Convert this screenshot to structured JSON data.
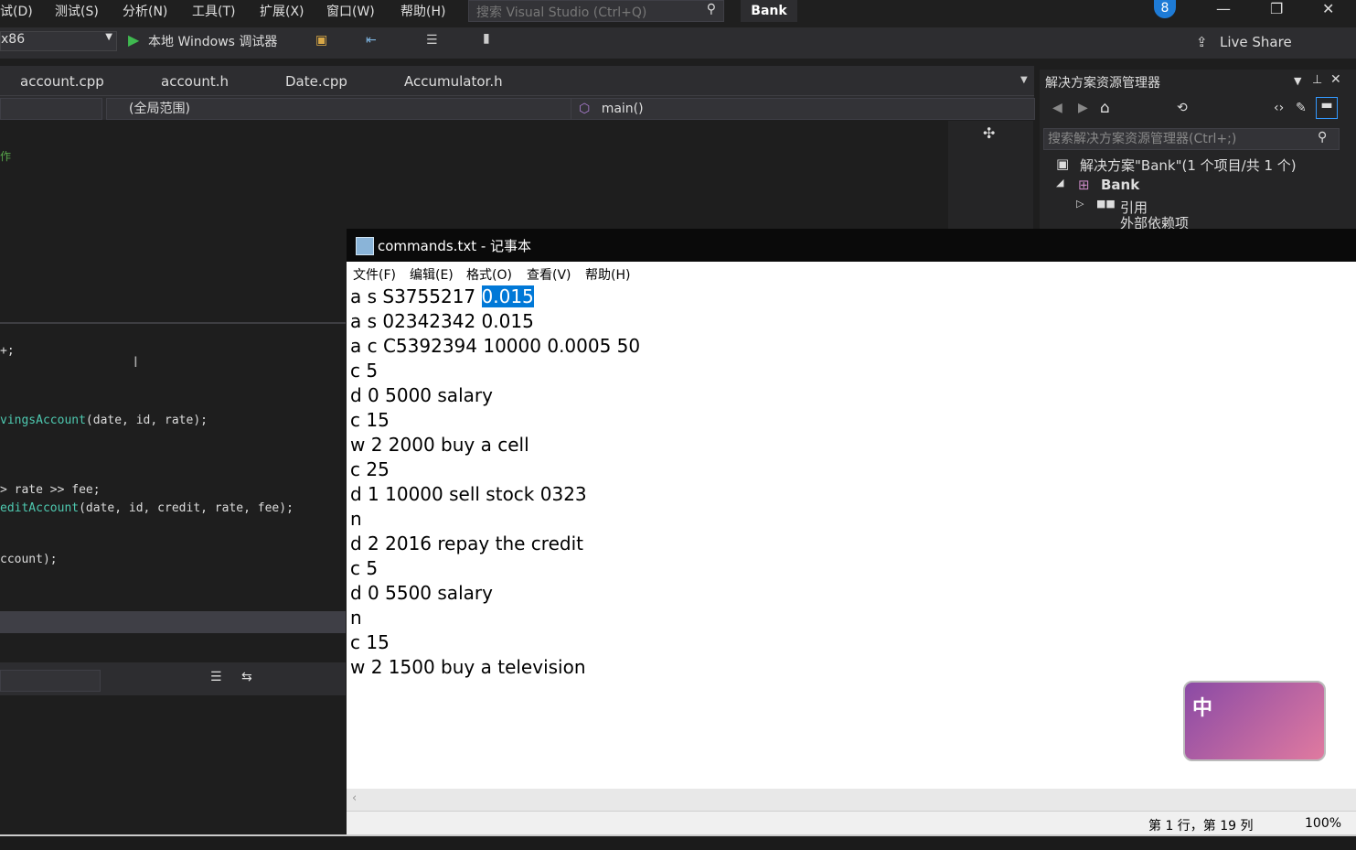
{
  "vs": {
    "menu": [
      "试(D)",
      "测试(S)",
      "分析(N)",
      "工具(T)",
      "扩展(X)",
      "窗口(W)",
      "帮助(H)"
    ],
    "search_placeholder": "搜索 Visual Studio (Ctrl+Q)",
    "solution_name": "Bank",
    "notifications": "8",
    "live_share": "Live Share",
    "platform": "x86",
    "debugger": "本地 Windows 调试器",
    "tabs": [
      "account.cpp",
      "account.h",
      "Date.cpp",
      "Accumulator.h"
    ],
    "scope": "(全局范围)",
    "function": "main()",
    "editor_fragment": "作",
    "code": [
      "+;",
      "vingsAccount(date, id, rate);",
      "> rate >> fee;",
      "editAccount(date, id, credit, rate, fee);",
      "ccount);"
    ]
  },
  "solution_explorer": {
    "title": "解决方案资源管理器",
    "search_placeholder": "搜索解决方案资源管理器(Ctrl+;)",
    "tree": [
      "解决方案\"Bank\"(1 个项目/共 1 个)",
      "Bank",
      "引用",
      "外部依赖项"
    ]
  },
  "notepad": {
    "title": "commands.txt - 记事本",
    "menu": [
      "文件(F)",
      "编辑(E)",
      "格式(O)",
      "查看(V)",
      "帮助(H)"
    ],
    "first_line_prefix": "a s S3755217 ",
    "first_line_selected": "0.015",
    "lines": [
      "a s 02342342 0.015",
      "a c C5392394 10000 0.0005 50",
      "c 5",
      "d 0 5000 salary",
      "c 15",
      "w 2 2000 buy a cell",
      "c 25",
      "d 1 10000 sell stock 0323",
      "n",
      "d 2 2016 repay the credit",
      "c 5",
      "d 0 5500 salary",
      "n",
      "c 15",
      "w 2 1500 buy a television"
    ],
    "status_position": "第 1 行，第 19 列",
    "status_zoom": "100%"
  },
  "ime": {
    "label": "中"
  }
}
